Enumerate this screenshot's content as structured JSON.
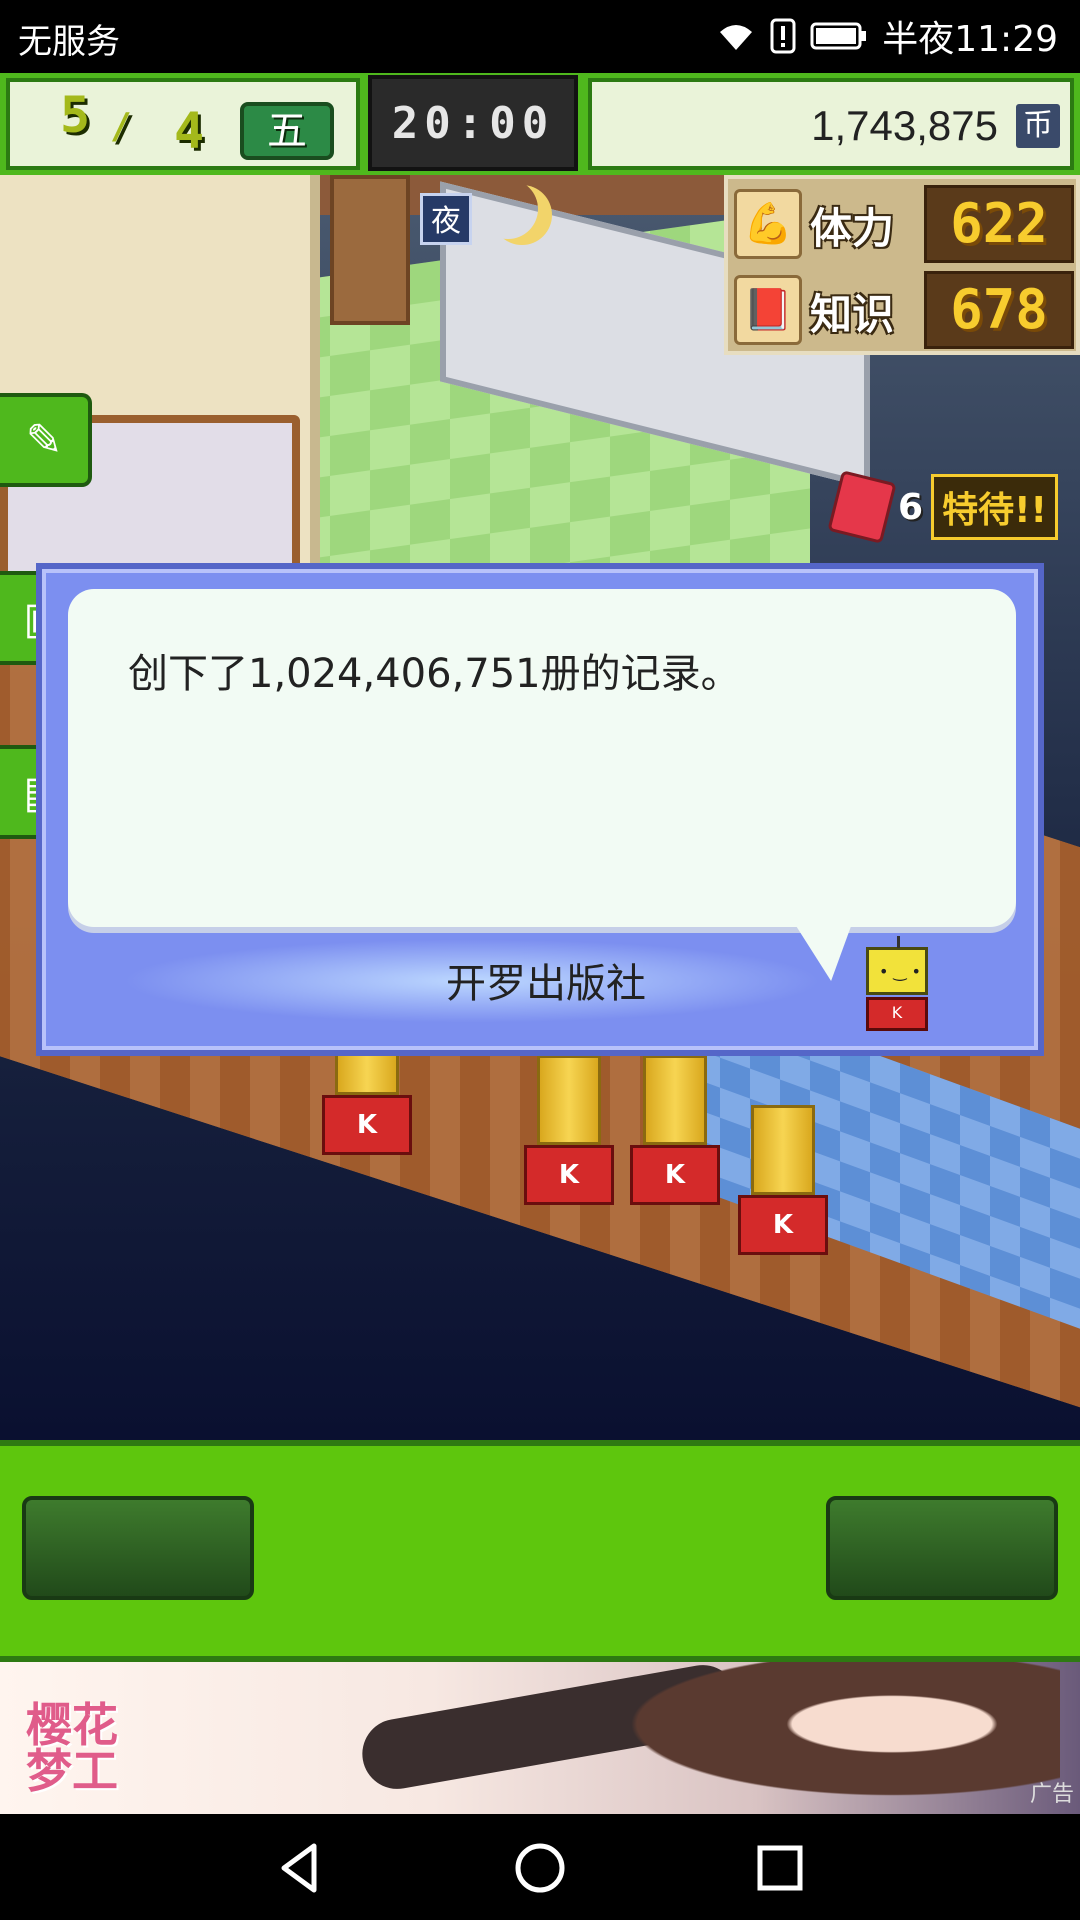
{
  "status_bar": {
    "carrier": "无服务",
    "time": "半夜11:29",
    "icons": [
      "wifi-icon",
      "alert-icon",
      "battery-icon"
    ]
  },
  "hud": {
    "month": "5",
    "week": "4",
    "weekday": "五",
    "time": "20:00",
    "money": "1,743,875",
    "currency": "币"
  },
  "world": {
    "night_badge": "夜",
    "stats": [
      {
        "icon": "muscle-icon",
        "label": "体力",
        "value": "622"
      },
      {
        "icon": "book-icon",
        "label": "知识",
        "value": "678"
      }
    ],
    "bonus": {
      "count": "6",
      "label": "特待!!"
    }
  },
  "dialog": {
    "message": "创下了1,024,406,751册的记录。",
    "speaker": "开罗出版社"
  },
  "bottom_bar": {
    "left_button_label": "",
    "right_button_label": ""
  },
  "ad": {
    "logo_line1": "樱花",
    "logo_line2": "梦工",
    "tag": "广告"
  },
  "colors": {
    "hud_green": "#4fb81d",
    "dialog_blue": "#7c8ff0",
    "bottom_green": "#5ec60d",
    "stat_gold": "#f7cc2e"
  }
}
